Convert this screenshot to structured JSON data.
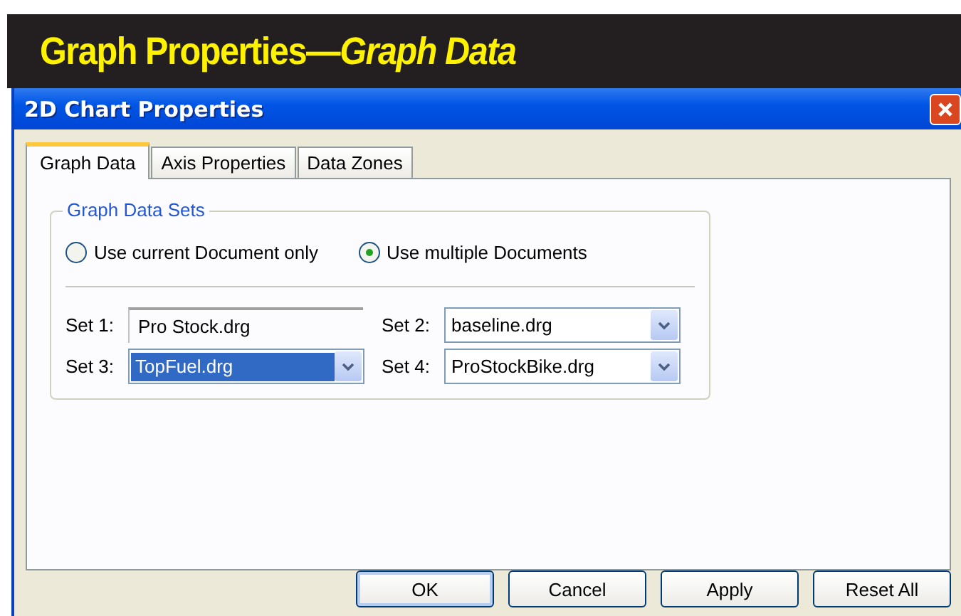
{
  "banner": {
    "title": "Graph Properties—*Graph Data*"
  },
  "window": {
    "title": "2D Chart Properties"
  },
  "tabs": [
    {
      "label": "Graph Data",
      "selected": true
    },
    {
      "label": "Axis Properties",
      "selected": false
    },
    {
      "label": "Data Zones",
      "selected": false
    }
  ],
  "group": {
    "title": "Graph Data Sets",
    "radios": [
      {
        "label": "Use current Document only",
        "selected": false
      },
      {
        "label": "Use multiple Documents",
        "selected": true
      }
    ],
    "sets": [
      {
        "label": "Set 1:",
        "value": "Pro Stock.drg",
        "kind": "text",
        "highlighted": false
      },
      {
        "label": "Set 2:",
        "value": "baseline.drg",
        "kind": "dropdown",
        "highlighted": false
      },
      {
        "label": "Set 3:",
        "value": "TopFuel.drg",
        "kind": "dropdown",
        "highlighted": true
      },
      {
        "label": "Set 4:",
        "value": "ProStockBike.drg",
        "kind": "dropdown",
        "highlighted": false
      }
    ]
  },
  "buttons": [
    {
      "label": "OK",
      "default": true
    },
    {
      "label": "Cancel",
      "default": false
    },
    {
      "label": "Apply",
      "default": false
    },
    {
      "label": "Reset All",
      "default": false
    }
  ]
}
